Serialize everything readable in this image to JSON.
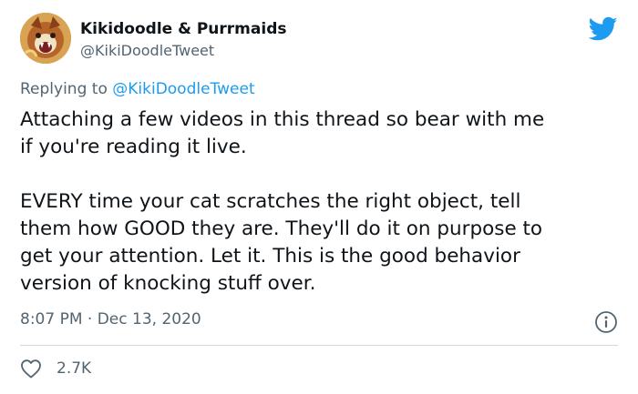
{
  "author": {
    "display_name": "Kikidoodle & Purrmaids",
    "handle": "@KikiDoodleTweet"
  },
  "reply": {
    "prefix": "Replying to ",
    "mention": "@KikiDoodleTweet"
  },
  "tweet": {
    "paragraph1": [
      "Attaching a few videos in this thread so bear with me",
      "if you're reading it live."
    ],
    "paragraph2": [
      "EVERY time your cat scratches the right object, tell",
      "them how GOOD they are. They'll do it on purpose to",
      "get your attention. Let it. This is the good behavior",
      "version of knocking stuff over."
    ],
    "timestamp": "8:07 PM · Dec 13, 2020"
  },
  "stats": {
    "likes": "2.7K"
  },
  "icons": {
    "brand": "twitter-bird-icon",
    "info": "info-icon",
    "like": "heart-icon"
  },
  "colors": {
    "accent": "#1d9bf0",
    "secondary_text": "#536471",
    "primary_text": "#0f1419",
    "divider": "#cfd9de"
  }
}
